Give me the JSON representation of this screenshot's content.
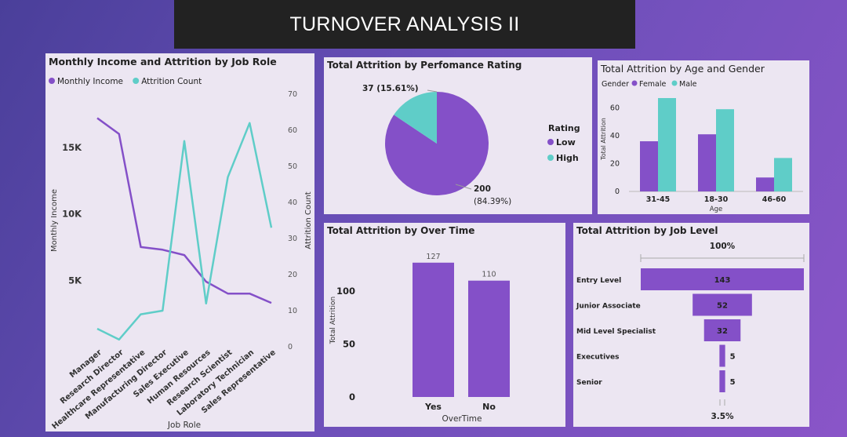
{
  "page_title": "TURNOVER ANALYSIS II",
  "chart_data": [
    {
      "type": "line",
      "title": "Monthly Income and Attrition by Job Role",
      "xlabel": "Job Role",
      "ylabel": "Monthly Income",
      "y2label": "Attrition Count",
      "ylim": [
        0,
        19000
      ],
      "y2lim": [
        0,
        70
      ],
      "y_ticks": [
        "5K",
        "10K",
        "15K"
      ],
      "y2_ticks": [
        "0",
        "10",
        "20",
        "30",
        "40",
        "50",
        "60",
        "70"
      ],
      "categories": [
        "Manager",
        "Research Director",
        "Healthcare Representative",
        "Manufacturing Director",
        "Sales Executive",
        "Human Resources",
        "Research Scientist",
        "Laboratory Technician",
        "Sales Representative"
      ],
      "series": [
        {
          "name": "Monthly Income",
          "axis": "left",
          "color": "#8450c8",
          "values": [
            17200,
            16000,
            7500,
            7300,
            6900,
            4900,
            4000,
            4000,
            3300
          ]
        },
        {
          "name": "Attrition Count",
          "axis": "right",
          "color": "#5fcdc8",
          "values": [
            5,
            2,
            9,
            10,
            57,
            12,
            47,
            62,
            33
          ]
        }
      ],
      "legend": "top-left"
    },
    {
      "type": "pie",
      "title": "Total Attrition by Perfomance Rating",
      "legend_title": "Rating",
      "slices": [
        {
          "name": "Low",
          "value": 200,
          "label_value": "200",
          "label_pct": "(84.39%)",
          "color": "#8450c8"
        },
        {
          "name": "High",
          "value": 37,
          "label": "37 (15.61%)",
          "color": "#5fcdc8"
        }
      ],
      "legend": "right"
    },
    {
      "type": "bar",
      "title": "Total Attrition by Age and Gender",
      "legend_title": "Gender",
      "xlabel": "Age",
      "ylabel": "Total Attrition",
      "categories": [
        "31-45",
        "18-30",
        "46-60"
      ],
      "ylim": [
        0,
        76
      ],
      "y_ticks": [
        0,
        20,
        40,
        60
      ],
      "series": [
        {
          "name": "Female",
          "color": "#8450c8",
          "values": [
            36,
            41,
            10
          ]
        },
        {
          "name": "Male",
          "color": "#5fcdc8",
          "values": [
            67,
            59,
            24
          ]
        }
      ],
      "legend": "top-left"
    },
    {
      "type": "bar",
      "title": "Total Attrition by Over Time",
      "xlabel": "OverTime",
      "ylabel": "Total Attrition",
      "categories": [
        "Yes",
        "No"
      ],
      "values": [
        127,
        110
      ],
      "data_labels": [
        "127",
        "110"
      ],
      "ylim": [
        0,
        135
      ],
      "y_ticks": [
        0,
        50,
        100
      ],
      "color": "#8450c8"
    },
    {
      "type": "funnel",
      "title": "Total Attrition by Job Level",
      "categories": [
        "Entry Level",
        "Junior Associate",
        "Mid Level Specialist",
        "Executives",
        "Senior"
      ],
      "values": [
        143,
        52,
        32,
        5,
        5
      ],
      "data_labels": [
        "143",
        "52",
        "32",
        "5",
        "5"
      ],
      "top_label": "100%",
      "bottom_label": "3.5%",
      "color": "#8450c8"
    }
  ]
}
